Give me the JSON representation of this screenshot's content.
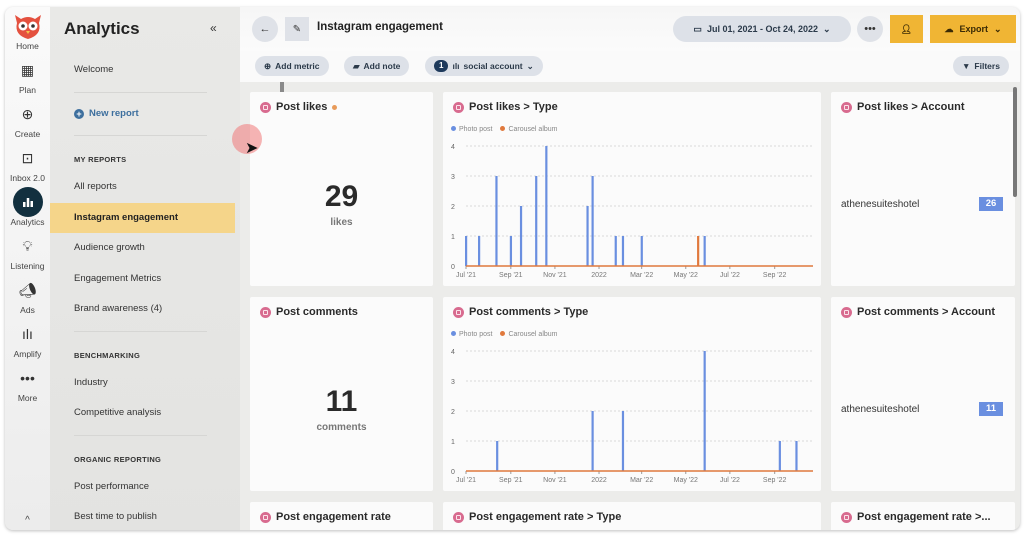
{
  "rail": {
    "items": [
      {
        "label": "Home",
        "icon": "owl-logo-icon"
      },
      {
        "label": "Plan",
        "icon": "calendar-icon"
      },
      {
        "label": "Create",
        "icon": "plus-circle-icon"
      },
      {
        "label": "Inbox 2.0",
        "icon": "inbox-icon"
      },
      {
        "label": "Analytics",
        "icon": "bar-chart-icon",
        "active": true
      },
      {
        "label": "Listening",
        "icon": "lightbulb-icon"
      },
      {
        "label": "Ads",
        "icon": "megaphone-icon"
      },
      {
        "label": "Amplify",
        "icon": "amplify-icon"
      },
      {
        "label": "More",
        "icon": "more-icon"
      }
    ]
  },
  "panel": {
    "title": "Analytics",
    "collapse": "«",
    "welcome": "Welcome",
    "new_report": "New report",
    "my_reports_head": "MY REPORTS",
    "my_reports": [
      "All reports",
      "Instagram engagement",
      "Audience growth",
      "Engagement Metrics",
      "Brand awareness (4)"
    ],
    "benchmarking_head": "BENCHMARKING",
    "benchmarking": [
      "Industry",
      "Competitive analysis"
    ],
    "organic_head": "ORGANIC REPORTING",
    "organic": [
      "Post performance",
      "Best time to publish"
    ]
  },
  "header": {
    "report_title": "Instagram engagement",
    "date_range": "Jul 01, 2021 - Oct 24, 2022",
    "export_label": "Export",
    "add_metric": "Add metric",
    "add_note": "Add note",
    "social_count": "1",
    "social_label": "social account",
    "filters": "Filters"
  },
  "colors": {
    "accent": "#f0b534",
    "photo": "#6a8fe0",
    "carousel": "#e0793d",
    "active_nav": "#f5d58a"
  },
  "cards": {
    "likes": {
      "title": "Post likes",
      "value": "29",
      "unit": "likes"
    },
    "likes_type": {
      "title": "Post likes > Type"
    },
    "likes_account": {
      "title": "Post likes > Account",
      "account": "athenesuiteshotel",
      "value": "26"
    },
    "comments": {
      "title": "Post comments",
      "value": "11",
      "unit": "comments"
    },
    "comments_type": {
      "title": "Post comments > Type"
    },
    "comments_account": {
      "title": "Post comments > Account",
      "account": "athenesuiteshotel",
      "value": "11"
    },
    "eng": {
      "title": "Post engagement rate"
    },
    "eng_type": {
      "title": "Post engagement rate > Type"
    },
    "eng_account": {
      "title": "Post engagement rate >..."
    }
  },
  "chart_data": [
    {
      "type": "bar",
      "title": "Post likes > Type",
      "legend": [
        "Photo post",
        "Carousel album"
      ],
      "legend_position": "top-left",
      "x_start": "2021-07-01",
      "x_end": "2022-10-24",
      "xticks": [
        {
          "label": "Jul '21",
          "day": 0
        },
        {
          "label": "Sep '21",
          "day": 62
        },
        {
          "label": "Nov '21",
          "day": 123
        },
        {
          "label": "2022",
          "day": 184
        },
        {
          "label": "Mar '22",
          "day": 243
        },
        {
          "label": "May '22",
          "day": 304
        },
        {
          "label": "Jul '22",
          "day": 365
        },
        {
          "label": "Sep '22",
          "day": 427
        }
      ],
      "yticks": [
        0,
        1,
        2,
        3,
        4
      ],
      "ylim": [
        0,
        4
      ],
      "grid": true,
      "series": [
        {
          "name": "Photo post",
          "points": [
            [
              0,
              1
            ],
            [
              18,
              1
            ],
            [
              42,
              3
            ],
            [
              62,
              1
            ],
            [
              76,
              2
            ],
            [
              97,
              3
            ],
            [
              111,
              4
            ],
            [
              168,
              2
            ],
            [
              175,
              3
            ],
            [
              207,
              1
            ],
            [
              217,
              1
            ],
            [
              243,
              1
            ],
            [
              330,
              1
            ]
          ]
        },
        {
          "name": "Carousel album",
          "points": [
            [
              321,
              1
            ]
          ]
        }
      ]
    },
    {
      "type": "bar",
      "title": "Post comments > Type",
      "legend": [
        "Photo post",
        "Carousel album"
      ],
      "legend_position": "top-left",
      "x_start": "2021-07-01",
      "x_end": "2022-10-24",
      "xticks": [
        {
          "label": "Jul '21",
          "day": 0
        },
        {
          "label": "Sep '21",
          "day": 62
        },
        {
          "label": "Nov '21",
          "day": 123
        },
        {
          "label": "2022",
          "day": 184
        },
        {
          "label": "Mar '22",
          "day": 243
        },
        {
          "label": "May '22",
          "day": 304
        },
        {
          "label": "Jul '22",
          "day": 365
        },
        {
          "label": "Sep '22",
          "day": 427
        }
      ],
      "yticks": [
        0,
        1,
        2,
        3,
        4
      ],
      "ylim": [
        0,
        4
      ],
      "grid": true,
      "series": [
        {
          "name": "Photo post",
          "points": [
            [
              43,
              1
            ],
            [
              175,
              2
            ],
            [
              217,
              2
            ],
            [
              330,
              4
            ],
            [
              434,
              1
            ],
            [
              457,
              1
            ]
          ]
        },
        {
          "name": "Carousel album",
          "points": []
        }
      ]
    }
  ]
}
